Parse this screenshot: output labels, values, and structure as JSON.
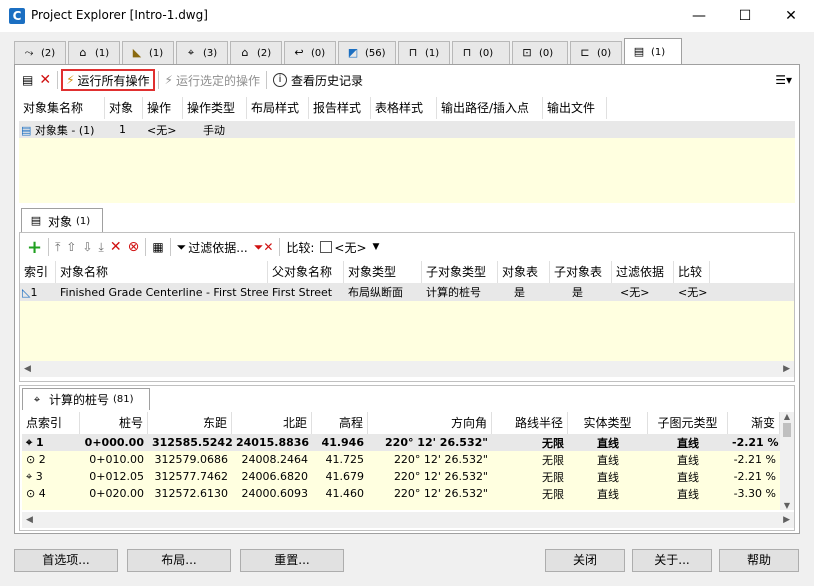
{
  "window": {
    "title": "Project Explorer [Intro-1.dwg]",
    "minimize": "—",
    "maximize": "☐",
    "close": "✕"
  },
  "tabs": [
    {
      "icon": "⤳",
      "count": "(2)"
    },
    {
      "icon": "⌂",
      "count": "(1)"
    },
    {
      "icon": "◣",
      "count": "(1)"
    },
    {
      "icon": "⌖",
      "count": "(3)"
    },
    {
      "icon": "⌂",
      "count": "(2)"
    },
    {
      "icon": "↩",
      "count": "(0)"
    },
    {
      "icon": "◩",
      "count": "(56)"
    },
    {
      "icon": "⊓",
      "count": "(1)"
    },
    {
      "icon": "⊓",
      "count": "(0)"
    },
    {
      "icon": "⊡",
      "count": "(0)"
    },
    {
      "icon": "⊏",
      "count": "(0)"
    },
    {
      "icon": "▤",
      "count": "(1)"
    }
  ],
  "toolbar1": {
    "new": "▤",
    "delete": "✕",
    "run_all": "运行所有操作",
    "run_selected": "运行选定的操作",
    "history": "查看历史记录",
    "menu": "☰▾"
  },
  "objset_table": {
    "headers": [
      "对象集名称",
      "对象",
      "操作",
      "操作类型",
      "布局样式",
      "报告样式",
      "表格样式",
      "输出路径/插入点",
      "输出文件"
    ],
    "row": {
      "name": "对象集 - (1)",
      "count": "1",
      "op": "<无>",
      "optype": "手动"
    }
  },
  "objects_tab": {
    "label": "对象",
    "count": "(1)"
  },
  "toolbar2": {
    "add": "+",
    "filter": "过滤依据...",
    "compare": "比较:",
    "compare_value": "<无>"
  },
  "objects_table": {
    "headers": [
      "索引",
      "对象名称",
      "父对象名称",
      "对象类型",
      "子对象类型",
      "对象表",
      "子对象表",
      "过滤依据",
      "比较"
    ],
    "row": {
      "index": "1",
      "name": "Finished Grade Centerline - First Street",
      "parent": "First Street",
      "type": "布局纵断面",
      "subtype": "计算的桩号",
      "objtable": "是",
      "subtable": "是",
      "filter": "<无>",
      "compare": "<无>"
    }
  },
  "stations_tab": {
    "label": "计算的桩号",
    "count": "(81)"
  },
  "stations_table": {
    "headers": [
      "点索引",
      "桩号",
      "东距",
      "北距",
      "高程",
      "方向角",
      "路线半径",
      "实体类型",
      "子图元类型",
      "渐变"
    ],
    "rows": [
      {
        "idx": "1",
        "station": "0+000.00",
        "east": "312585.5242",
        "north": "24015.8836",
        "elev": "41.946",
        "bearing": "220° 12' 26.532\"",
        "radius": "无限",
        "etype": "直线",
        "stype": "直线",
        "slope": "-2.21 %"
      },
      {
        "idx": "2",
        "station": "0+010.00",
        "east": "312579.0686",
        "north": "24008.2464",
        "elev": "41.725",
        "bearing": "220° 12' 26.532\"",
        "radius": "无限",
        "etype": "直线",
        "stype": "直线",
        "slope": "-2.21 %"
      },
      {
        "idx": "3",
        "station": "0+012.05",
        "east": "312577.7462",
        "north": "24006.6820",
        "elev": "41.679",
        "bearing": "220° 12' 26.532\"",
        "radius": "无限",
        "etype": "直线",
        "stype": "直线",
        "slope": "-2.21 %"
      },
      {
        "idx": "4",
        "station": "0+020.00",
        "east": "312572.6130",
        "north": "24000.6093",
        "elev": "41.460",
        "bearing": "220° 12' 26.532\"",
        "radius": "无限",
        "etype": "直线",
        "stype": "直线",
        "slope": "-3.30 %"
      }
    ]
  },
  "buttons": {
    "prefs": "首选项...",
    "layout": "布局...",
    "reset": "重置...",
    "close": "关闭",
    "about": "关于...",
    "help": "帮助"
  }
}
